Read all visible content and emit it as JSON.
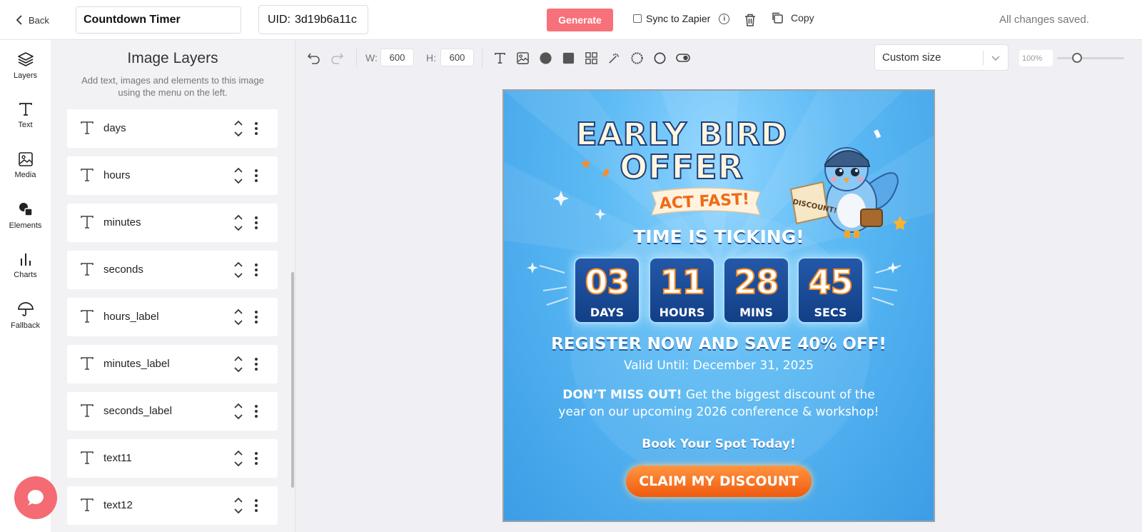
{
  "header": {
    "back_label": "Back",
    "template_name": "Countdown Timer",
    "uid_label": "UID:",
    "uid_value": "3d19b6a11c",
    "generate_label": "Generate",
    "sync_label": "Sync to Zapier",
    "copy_label": "Copy",
    "status": "All changes saved."
  },
  "sidenav": {
    "items": [
      {
        "label": "Layers",
        "icon": "layers-icon"
      },
      {
        "label": "Text",
        "icon": "text-icon"
      },
      {
        "label": "Media",
        "icon": "image-icon"
      },
      {
        "label": "Elements",
        "icon": "shapes-icon"
      },
      {
        "label": "Charts",
        "icon": "bar-chart-icon"
      },
      {
        "label": "Fallback",
        "icon": "umbrella-icon"
      }
    ]
  },
  "panel": {
    "title": "Image Layers",
    "subtitle": "Add text, images and elements to this image using the menu on the left.",
    "layers": [
      "days",
      "hours",
      "minutes",
      "seconds",
      "hours_label",
      "minutes_label",
      "seconds_label",
      "text11",
      "text12"
    ]
  },
  "toolbar": {
    "width_label": "W:",
    "width_value": "600",
    "height_label": "H:",
    "height_value": "600",
    "size_option": "Custom size",
    "zoom": "100%",
    "zoom_level": 0.3
  },
  "poster": {
    "headline_1": "EARLY BIRD",
    "headline_2": "OFFER",
    "ribbon": "ACT FAST!",
    "scroll_text": "DISCOUNT!",
    "ticking": "TIME IS TICKING!",
    "countdown": [
      {
        "value": "03",
        "label": "DAYS"
      },
      {
        "value": "11",
        "label": "HOURS"
      },
      {
        "value": "28",
        "label": "MINS"
      },
      {
        "value": "45",
        "label": "SECS"
      }
    ],
    "register": "REGISTER NOW AND SAVE 40% OFF!",
    "valid": "Valid Until: December 31, 2025",
    "dont_miss_bold": "DON’T MISS OUT!",
    "dont_miss_rest": " Get the biggest discount of the",
    "line2": "year on our upcoming 2026 conference & workshop!",
    "book": "Book Your Spot Today!",
    "cta": "CLAIM MY DISCOUNT"
  },
  "colors": {
    "accent": "#f7717a",
    "poster_blue": "#4aa8ec",
    "countdown_box": "#1a4a96",
    "cta_orange": "#f26a18"
  }
}
